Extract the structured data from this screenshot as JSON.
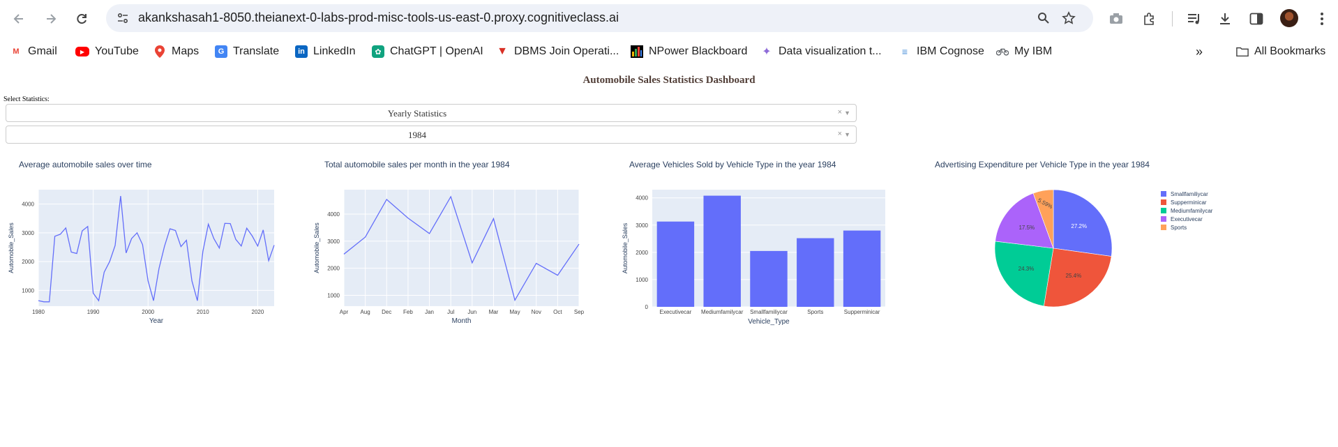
{
  "browser": {
    "url": "akankshasah1-8050.theianext-0-labs-prod-misc-tools-us-east-0.proxy.cognitiveclass.ai",
    "back_icon": "arrow-left-icon",
    "forward_icon": "arrow-right-icon",
    "reload_icon": "reload-icon"
  },
  "bookmarks": [
    {
      "label": "Gmail",
      "icon": "gmail-icon",
      "color": "#ea4335"
    },
    {
      "label": "YouTube",
      "icon": "youtube-icon",
      "color": "#ff0000"
    },
    {
      "label": "Maps",
      "icon": "maps-icon",
      "color": "#34a853"
    },
    {
      "label": "Translate",
      "icon": "translate-icon",
      "color": "#4285f4"
    },
    {
      "label": "LinkedIn",
      "icon": "linkedin-icon",
      "color": "#0a66c2"
    },
    {
      "label": "ChatGPT | OpenAI",
      "icon": "chatgpt-icon",
      "color": "#10a37f"
    },
    {
      "label": "DBMS Join Operati...",
      "icon": "dbms-icon",
      "color": "#d93025"
    },
    {
      "label": "NPower Blackboard",
      "icon": "npower-icon",
      "color": "#f4b400"
    },
    {
      "label": "Data visualization t...",
      "icon": "dataviz-icon",
      "color": "#8e6bd8"
    },
    {
      "label": "IBM Cognose",
      "icon": "ibm-cognos-icon",
      "color": "#4a90d9"
    },
    {
      "label": "My IBM",
      "icon": "bike-icon",
      "color": "#5f6368"
    }
  ],
  "all_bookmarks_label": "All Bookmarks",
  "dashboard": {
    "title": "Automobile Sales Statistics Dashboard",
    "select_label": "Select Statistics:",
    "dropdown_stat": "Yearly Statistics",
    "dropdown_year": "1984",
    "clear_symbol": "×"
  },
  "chart_data": [
    {
      "type": "line",
      "title": "Average automobile sales over time",
      "xlabel": "Year",
      "ylabel": "Automobile_Sales",
      "x": [
        1980,
        1981,
        1982,
        1983,
        1984,
        1985,
        1986,
        1987,
        1988,
        1989,
        1990,
        1991,
        1992,
        1993,
        1994,
        1995,
        1996,
        1997,
        1998,
        1999,
        2000,
        2001,
        2002,
        2003,
        2004,
        2005,
        2006,
        2007,
        2008,
        2009,
        2010,
        2011,
        2012,
        2013,
        2014,
        2015,
        2016,
        2017,
        2018,
        2019,
        2020,
        2021,
        2022,
        2023
      ],
      "y": [
        640,
        600,
        600,
        2880,
        2950,
        3170,
        2330,
        2280,
        3070,
        3220,
        900,
        640,
        1630,
        2000,
        2560,
        4280,
        2300,
        2800,
        3000,
        2590,
        1330,
        640,
        1760,
        2530,
        3140,
        3080,
        2520,
        2740,
        1330,
        640,
        2350,
        3300,
        2800,
        2470,
        3330,
        3320,
        2770,
        2540,
        3160,
        2890,
        2540,
        3100,
        2030,
        2570
      ],
      "xticks": [
        "1980",
        "1990",
        "2000",
        "2010",
        "2020"
      ],
      "yticks": [
        "1000",
        "2000",
        "3000",
        "4000"
      ],
      "xlim": [
        1980,
        2023
      ],
      "ylim": [
        450,
        4500
      ]
    },
    {
      "type": "line",
      "title": "Total automobile sales per month in the year 1984",
      "xlabel": "Month",
      "ylabel": "Automobile_Sales",
      "categories": [
        "Apr",
        "Aug",
        "Dec",
        "Feb",
        "Jan",
        "Jul",
        "Jun",
        "Mar",
        "May",
        "Nov",
        "Oct",
        "Sep"
      ],
      "values": [
        2520,
        3150,
        4540,
        3850,
        3280,
        4640,
        2200,
        3830,
        820,
        2180,
        1740,
        2890
      ],
      "yticks": [
        "1000",
        "2000",
        "3000",
        "4000"
      ],
      "ylim": [
        600,
        4900
      ]
    },
    {
      "type": "bar",
      "title": "Average Vehicles Sold by Vehicle Type in the year 1984",
      "xlabel": "Vehicle_Type",
      "ylabel": "Automobile_Sales",
      "categories": [
        "Executivecar",
        "Mediumfamilycar",
        "Smallfamiliycar",
        "Sports",
        "Supperminicar"
      ],
      "values": [
        3130,
        4080,
        2050,
        2520,
        2800
      ],
      "yticks": [
        "0",
        "1000",
        "2000",
        "3000",
        "4000"
      ],
      "ylim": [
        0,
        4300
      ]
    },
    {
      "type": "pie",
      "title": "Advertising Expenditure per Vehicle Type in the year 1984",
      "labels": [
        "Smallfamiliycar",
        "Supperminicar",
        "Mediumfamilycar",
        "Executivecar",
        "Sports"
      ],
      "values": [
        27.2,
        25.4,
        24.3,
        17.5,
        5.59
      ],
      "value_labels": [
        "27.2%",
        "25.4%",
        "24.3%",
        "17.5%",
        "5.59%"
      ],
      "colors": [
        "#636efa",
        "#ef553b",
        "#00cc96",
        "#ab63fa",
        "#ffa15a"
      ]
    }
  ]
}
